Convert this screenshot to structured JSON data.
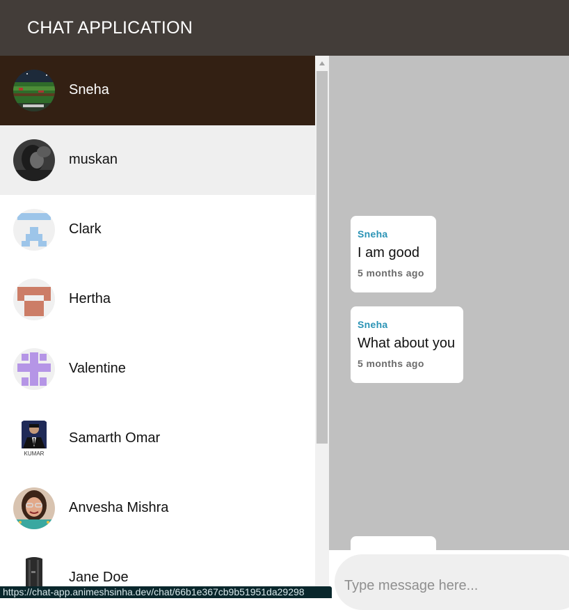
{
  "header": {
    "title": "CHAT APPLICATION"
  },
  "contacts": [
    {
      "name": "Sneha",
      "avatar": "landscape-photo"
    },
    {
      "name": "muskan",
      "avatar": "dark-portrait-photo"
    },
    {
      "name": "Clark",
      "avatar": "blue-pixel-identicon"
    },
    {
      "name": "Hertha",
      "avatar": "terracotta-pixel-identicon"
    },
    {
      "name": "Valentine",
      "avatar": "purple-pixel-identicon"
    },
    {
      "name": "Samarth Omar",
      "avatar": "suit-portrait-photo"
    },
    {
      "name": "Anvesha Mishra",
      "avatar": "smiling-portrait-photo"
    },
    {
      "name": "Jane Doe",
      "avatar": "device-photo"
    }
  ],
  "messages": [
    {
      "sender": "Sneha",
      "text": "I am good",
      "time": "5 months ago"
    },
    {
      "sender": "Sneha",
      "text": "What about you",
      "time": "5 months ago"
    }
  ],
  "composer": {
    "placeholder": "Type message here..."
  },
  "status_bar": {
    "url": "https://chat-app.animeshsinha.dev/chat/66b1e367cb9b51951da29298"
  },
  "colors": {
    "header_bg": "#433d39",
    "active_contact_bg": "#332013",
    "chat_bg": "#c0c0c0",
    "sender_name": "#2a93b5"
  }
}
